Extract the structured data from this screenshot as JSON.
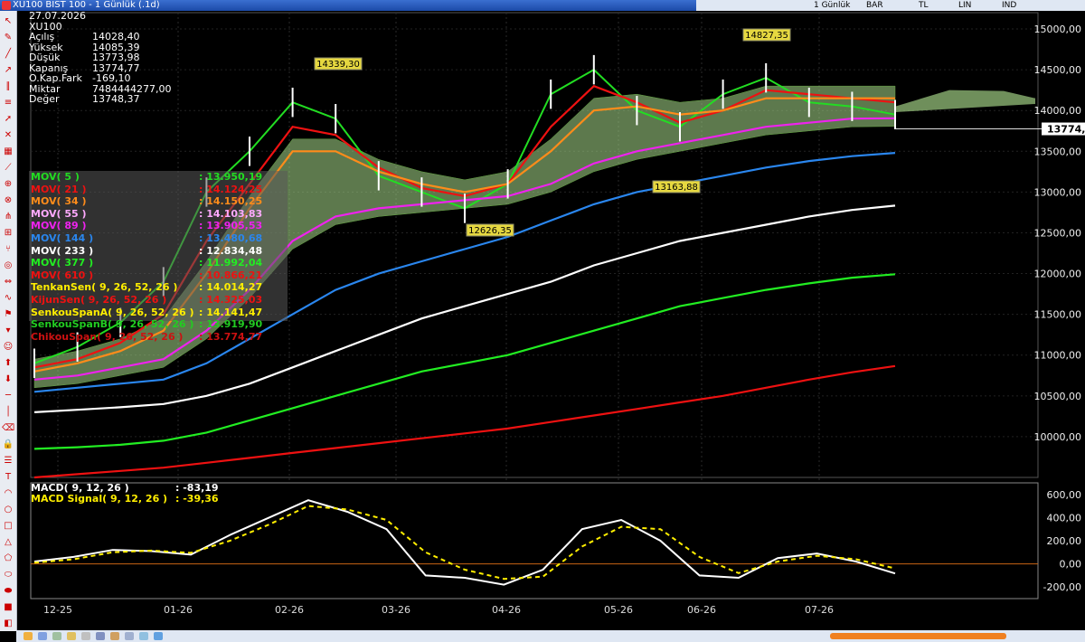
{
  "window": {
    "title": "XU100 BIST 100 - 1 Günlük (.1d)",
    "toolbar": {
      "period": "1 Günlük",
      "chart_type": "BAR",
      "currency": "TL",
      "scale": "LIN",
      "indicator": "IND"
    }
  },
  "info": {
    "date": "27.07.2026",
    "symbol": "XU100",
    "rows": [
      {
        "k": "Açılış",
        "v": "14028,40"
      },
      {
        "k": "Yüksek",
        "v": "14085,39"
      },
      {
        "k": "Düşük",
        "v": "13773,98"
      },
      {
        "k": "Kapanış",
        "v": "13774,77"
      },
      {
        "k": "O.Kap.Fark",
        "v": "-169,10"
      },
      {
        "k": "Miktar",
        "v": "7484444277,00"
      },
      {
        "k": "Değer",
        "v": "13748,37"
      }
    ]
  },
  "indicators": [
    {
      "k": "MOV( 5 )",
      "v": ": 13.950,19",
      "color": "#22dd22"
    },
    {
      "k": "MOV( 21 )",
      "v": ": 14.124,25",
      "color": "#ee1111"
    },
    {
      "k": "MOV( 34 )",
      "v": ": 14.150,25",
      "color": "#ff8c1a"
    },
    {
      "k": "MOV( 55 )",
      "v": ": 14.103,83",
      "color": "#ffaaff"
    },
    {
      "k": "MOV( 89 )",
      "v": ": 13.905,53",
      "color": "#ee22ee"
    },
    {
      "k": "MOV( 144 )",
      "v": ": 13.480,68",
      "color": "#2a86ee"
    },
    {
      "k": "MOV( 233 )",
      "v": ": 12.834,48",
      "color": "#ffffff"
    },
    {
      "k": "MOV( 377 )",
      "v": ": 11.992,04",
      "color": "#22ee22"
    },
    {
      "k": "MOV( 610 )",
      "v": ": 10.866,21",
      "color": "#ee1111"
    },
    {
      "k": "TenkanSen( 9, 26, 52, 26 )",
      "v": ": 14.014,27",
      "color": "#ffee00"
    },
    {
      "k": "KijunSen( 9, 26, 52, 26 )",
      "v": ": 14.325,03",
      "color": "#ee1111"
    },
    {
      "k": "SenkouSpanA( 9, 26, 52, 26 )",
      "v": ": 14.141,47",
      "color": "#ffee00"
    },
    {
      "k": "SenkouSpanB( 9, 26, 52, 26 )",
      "v": ": 13.919,90",
      "color": "#22cc22"
    },
    {
      "k": "ChikouSpan( 9, 26, 52, 26 )",
      "v": ": 13.774,77",
      "color": "#cc1111"
    }
  ],
  "macd_legend": [
    {
      "k": "MACD( 9, 12, 26 )",
      "v": ": -83,19",
      "color": "#ffffff"
    },
    {
      "k": "MACD Signal( 9, 12, 26 )",
      "v": ": -39,36",
      "color": "#ffee00"
    }
  ],
  "chart_data": [
    {
      "type": "line",
      "title": "XU100 BIST 100 - 1 Günlük (.1d)",
      "x_tick_labels": [
        "12-25",
        "01-26",
        "02-26",
        "03-26",
        "04-26",
        "05-26",
        "06-26",
        "07-26"
      ],
      "ylim": [
        9500,
        15200
      ],
      "y_tick_values": [
        10000,
        10500,
        11000,
        11500,
        12000,
        12500,
        13000,
        13500,
        14000,
        14500,
        15000
      ],
      "y_tick_labels": [
        "10000,00",
        "10500,00",
        "11000,00",
        "11500,00",
        "12000,00",
        "12500,00",
        "13000,00",
        "13500,00",
        "14000,00",
        "14500,00",
        "15000,00"
      ],
      "current_price_label": "13774,",
      "current_price": 13774.77,
      "annotations": [
        {
          "label": "14339,30",
          "x": "02-26",
          "value": 14339.3
        },
        {
          "label": "12626,35",
          "x": "04-26",
          "value": 12626.35
        },
        {
          "label": "14827,35",
          "x": "07-26",
          "value": 14827.35
        },
        {
          "label": "13163,88",
          "x": "06-26",
          "value": 13163.88
        }
      ],
      "series": [
        {
          "name": "Kapanış",
          "color": "#22dd22",
          "values": [
            10900,
            11100,
            11400,
            11900,
            13000,
            13500,
            14100,
            13900,
            13200,
            13000,
            12800,
            13100,
            14200,
            14500,
            14000,
            13800,
            14200,
            14400,
            14100,
            14050,
            13950
          ]
        },
        {
          "name": "MOV( 21 )",
          "color": "#ee1111",
          "values": [
            10850,
            10950,
            11150,
            11500,
            12400,
            13100,
            13800,
            13700,
            13300,
            13050,
            12950,
            13100,
            13800,
            14300,
            14100,
            13850,
            14000,
            14250,
            14200,
            14150,
            14100
          ]
        },
        {
          "name": "MOV( 34 )",
          "color": "#ff8c1a",
          "values": [
            10800,
            10900,
            11050,
            11300,
            12000,
            12800,
            13500,
            13500,
            13250,
            13100,
            13000,
            13100,
            13500,
            14000,
            14050,
            13950,
            14000,
            14150,
            14150,
            14150,
            14150
          ]
        },
        {
          "name": "MOV( 89 )",
          "color": "#ee22ee",
          "values": [
            10700,
            10750,
            10850,
            10950,
            11300,
            11800,
            12400,
            12700,
            12800,
            12850,
            12900,
            12950,
            13100,
            13350,
            13500,
            13600,
            13700,
            13800,
            13850,
            13900,
            13905
          ]
        },
        {
          "name": "MOV( 144 )",
          "color": "#2a86ee",
          "values": [
            10550,
            10600,
            10650,
            10700,
            10900,
            11200,
            11500,
            11800,
            12000,
            12150,
            12300,
            12450,
            12650,
            12850,
            13000,
            13100,
            13200,
            13300,
            13380,
            13440,
            13480
          ]
        },
        {
          "name": "MOV( 233 )",
          "color": "#ffffff",
          "values": [
            10300,
            10330,
            10360,
            10400,
            10500,
            10650,
            10850,
            11050,
            11250,
            11450,
            11600,
            11750,
            11900,
            12100,
            12250,
            12400,
            12500,
            12600,
            12700,
            12780,
            12834
          ]
        },
        {
          "name": "MOV( 377 )",
          "color": "#22ee22",
          "values": [
            9850,
            9870,
            9900,
            9950,
            10050,
            10200,
            10350,
            10500,
            10650,
            10800,
            10900,
            11000,
            11150,
            11300,
            11450,
            11600,
            11700,
            11800,
            11880,
            11950,
            11992
          ]
        },
        {
          "name": "MOV( 610 )",
          "color": "#ee1111",
          "values": [
            9500,
            9540,
            9580,
            9620,
            9680,
            9740,
            9800,
            9860,
            9920,
            9980,
            10040,
            10100,
            10180,
            10260,
            10340,
            10420,
            10500,
            10600,
            10700,
            10790,
            10866
          ]
        }
      ]
    },
    {
      "type": "line",
      "title": "MACD( 9, 12, 26 )",
      "x_tick_labels": [
        "12-25",
        "01-26",
        "02-26",
        "03-26",
        "04-26",
        "05-26",
        "06-26",
        "07-26"
      ],
      "ylim": [
        -300,
        700
      ],
      "y_tick_values": [
        -200,
        0,
        200,
        400,
        600
      ],
      "y_tick_labels": [
        "-200,00",
        "0,00",
        "200,00",
        "400,00",
        "600,00"
      ],
      "series": [
        {
          "name": "MACD( 9, 12, 26 )",
          "color": "#ffffff",
          "values": [
            20,
            60,
            120,
            110,
            80,
            250,
            400,
            550,
            450,
            300,
            -100,
            -120,
            -180,
            -50,
            300,
            380,
            200,
            -100,
            -120,
            50,
            90,
            20,
            -83
          ]
        },
        {
          "name": "MACD Signal( 9, 12, 26 )",
          "color": "#ffee00",
          "values": [
            10,
            40,
            100,
            115,
            95,
            200,
            340,
            500,
            470,
            380,
            100,
            -50,
            -130,
            -110,
            150,
            320,
            300,
            60,
            -80,
            20,
            70,
            40,
            -39
          ]
        }
      ]
    }
  ]
}
